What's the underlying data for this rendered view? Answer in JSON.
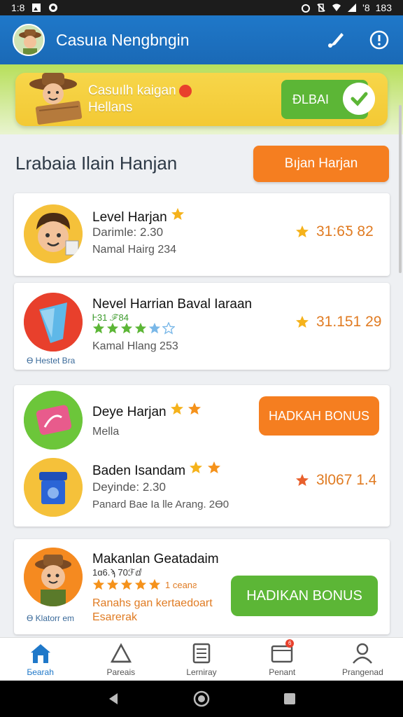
{
  "status_bar": {
    "time": "1:8",
    "battery": "183",
    "signal": "'8"
  },
  "app_bar": {
    "title": "Casuıa Nengbngin"
  },
  "banner": {
    "text_line1": "Casuılh kaigan",
    "text_line2": "Hellans",
    "button_label": "ÐLBAI"
  },
  "section": {
    "title": "Lrabaia Ilain Hanjan",
    "button_label": "Bıjan Harjan"
  },
  "items": [
    {
      "name": "Level Harjan",
      "sub1": "Darimle: 2.30",
      "sub2": "Namal Hairg 234",
      "score": "31:6Ƽ 82"
    },
    {
      "name": "Nevel Harrian Baval Iaraan",
      "tag": "Ꮀ31 ℱ84",
      "sub2": "Kamal Hlang 253",
      "footer": "Ɵ Hestet Bra",
      "score": "31.151 29"
    },
    {
      "name": "Deye Harjan",
      "sub1": "Mella",
      "button_label": "HADKAH BONUS"
    },
    {
      "name": "Baden Isandam",
      "sub1": "Deyinde: 2.30",
      "sub2": "Panard Bae Ia lle Arang. 2Ɵ0",
      "score": "3Ɩ067 1.4"
    },
    {
      "name": "Makanlan Geatadaim",
      "tag": "1ɑ6.ϡ 70ℱⅆ",
      "rating_text": "1 ceanƨ",
      "orange_line1": "Ranahs gan kertaedoart",
      "orange_line2": "Esarerak",
      "footer": "Ɵ Klatorr em",
      "button_label": "HADIKAN BONUS"
    }
  ],
  "bottom_nav": [
    {
      "label": "Ƃearah",
      "active": true
    },
    {
      "label": "Pareais"
    },
    {
      "label": "Lerniray"
    },
    {
      "label": "Penant",
      "badge": "6"
    },
    {
      "label": "Prangenad"
    }
  ],
  "colors": {
    "primary": "#1f78c9",
    "accent_orange": "#f57e20",
    "accent_green": "#5cb636",
    "banner_yellow": "#f3c934"
  }
}
